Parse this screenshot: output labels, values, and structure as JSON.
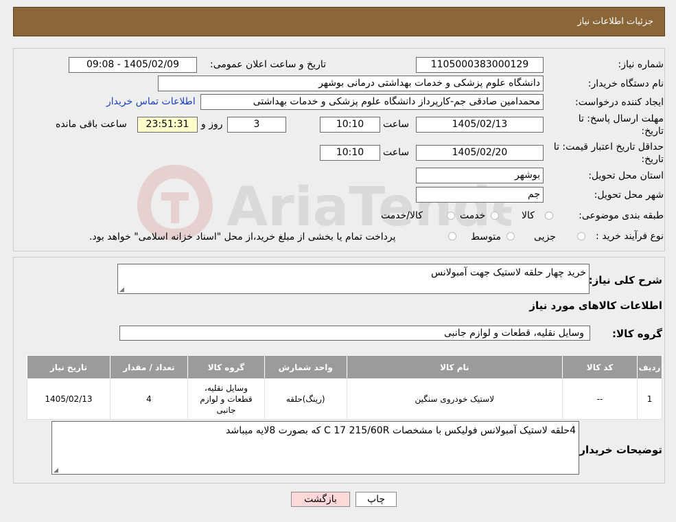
{
  "header": {
    "title": "جزئیات اطلاعات نیاز"
  },
  "fields": {
    "need_number_label": "شماره نیاز:",
    "need_number": "1105000383000129",
    "announce_label": "تاریخ و ساعت اعلان عمومی:",
    "announce_value": "1405/02/09 - 09:08",
    "buyer_org_label": "نام دستگاه خریدار:",
    "buyer_org": "دانشگاه علوم پزشکی و خدمات بهداشتی درمانی بوشهر",
    "requester_label": "ایجاد کننده درخواست:",
    "requester": "محمدامین صادقی جم-کارپرداز دانشگاه علوم پزشکی و خدمات بهداشتی",
    "contact_link": "اطلاعات تماس خریدار",
    "deadline_label_1": "مهلت ارسال پاسخ: تا",
    "deadline_label_2": "تاریخ:",
    "deadline_date": "1405/02/13",
    "time_label": "ساعت",
    "deadline_time": "10:10",
    "days_value": "3",
    "days_label": "روز و",
    "remaining_time": "23:51:31",
    "remaining_label": "ساعت باقی مانده",
    "validity_label_1": "حداقل تاریخ اعتبار قیمت: تا",
    "validity_label_2": "تاریخ:",
    "validity_date": "1405/02/20",
    "validity_time_label": "ساعت",
    "validity_time": "10:10",
    "province_label": "استان محل تحویل:",
    "province": "بوشهر",
    "city_label": "شهر محل تحویل:",
    "city": "جم",
    "category_label": "طبقه بندی موضوعی:",
    "category_options": [
      "کالا",
      "خدمت",
      "کالا/خدمت"
    ],
    "process_label": "نوع فرآیند خرید :",
    "process_options": [
      "جزیی",
      "متوسط"
    ],
    "process_note": "پرداخت تمام یا بخشی از مبلغ خرید،از محل \"اسناد خزانه اسلامی\" خواهد بود."
  },
  "description": {
    "label": "شرح کلی نیاز:",
    "value": "خرید چهار حلقه لاستیک جهت آمبولانس"
  },
  "goods_info_title": "اطلاعات کالاهای مورد نیاز",
  "goods_group": {
    "label": "گروه کالا:",
    "value": "وسایل نقلیه، قطعات و لوازم جانبی"
  },
  "table": {
    "headers": [
      "ردیف",
      "کد کالا",
      "نام کالا",
      "واحد شمارش",
      "گروه کالا",
      "تعداد / مقدار",
      "تاریخ نیاز"
    ],
    "rows": [
      [
        "1",
        "--",
        "لاستیک خودروی سنگین",
        "(رینگ)حلقه",
        "وسایل نقلیه، قطعات و لوازم جانبی",
        "4",
        "1405/02/13"
      ]
    ]
  },
  "buyer_notes": {
    "label": "توضیحات خریدار:",
    "value": "4حلقه لاستیک آمبولانس فولیکس با مشخصات C  17   215/60R    که بصورت 8لایه میباشد"
  },
  "buttons": {
    "print": "چاپ",
    "back": "بازگشت"
  },
  "watermark": {
    "text": "AriaTender.neT"
  }
}
